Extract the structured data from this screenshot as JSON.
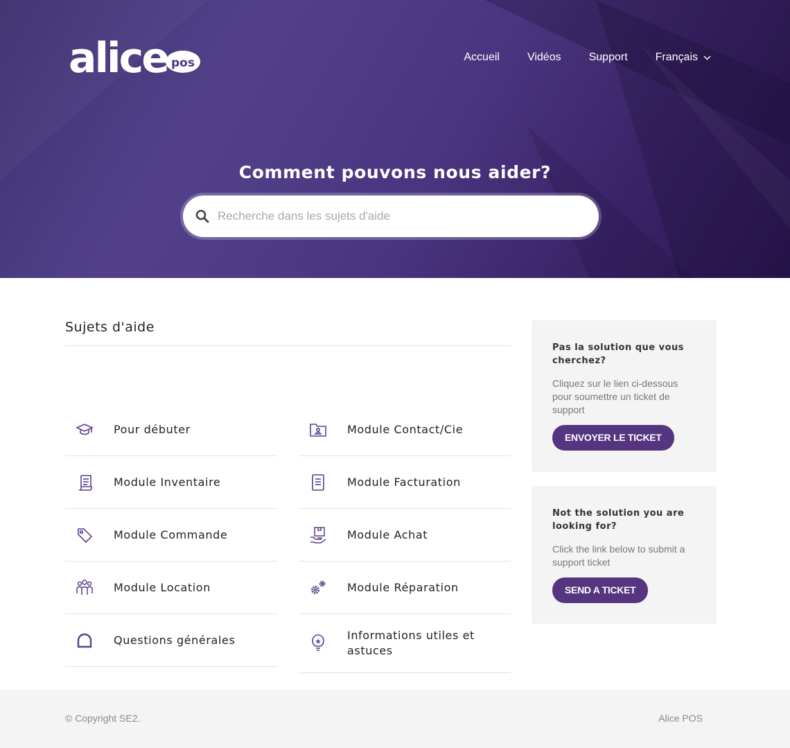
{
  "brand": {
    "logo_text": "alice",
    "logo_sub": "pos"
  },
  "nav": [
    {
      "label": "Accueil"
    },
    {
      "label": "Vidéos"
    },
    {
      "label": "Support"
    },
    {
      "label": "Français"
    }
  ],
  "hero": {
    "title": "Comment pouvons nous aider?",
    "search_placeholder": "Recherche dans les sujets d'aide"
  },
  "topics": {
    "heading": "Sujets d'aide",
    "left": [
      {
        "label": "Pour débuter",
        "icon": "graduation-cap-icon"
      },
      {
        "label": "Module Inventaire",
        "icon": "scroll-icon"
      },
      {
        "label": "Module Commande",
        "icon": "tag-icon"
      },
      {
        "label": "Module Location",
        "icon": "people-icon"
      },
      {
        "label": "Questions générales",
        "icon": "speech-bubble-icon"
      }
    ],
    "right": [
      {
        "label": "Module Contact/Cie",
        "icon": "contact-folder-icon"
      },
      {
        "label": "Module Facturation",
        "icon": "invoice-icon"
      },
      {
        "label": "Module Achat",
        "icon": "box-hand-icon"
      },
      {
        "label": "Module Réparation",
        "icon": "gears-icon"
      },
      {
        "label": "Informations utiles et astuces",
        "icon": "lightbulb-icon"
      }
    ]
  },
  "cards": [
    {
      "title": "Pas la solution que vous cherchez?",
      "text": "Cliquez sur le lien ci-dessous pour soumettre un ticket de support",
      "button": "Envoyer le ticket"
    },
    {
      "title": "Not the solution you are looking for?",
      "text": "Click the link below to submit a support ticket",
      "button": "Send a ticket"
    }
  ],
  "footer": {
    "copyright": "© Copyright SE2.",
    "brand": "Alice POS"
  },
  "colors": {
    "accent": "#55357f",
    "hero": "#4a3680",
    "icon": "#5a3f8a"
  }
}
